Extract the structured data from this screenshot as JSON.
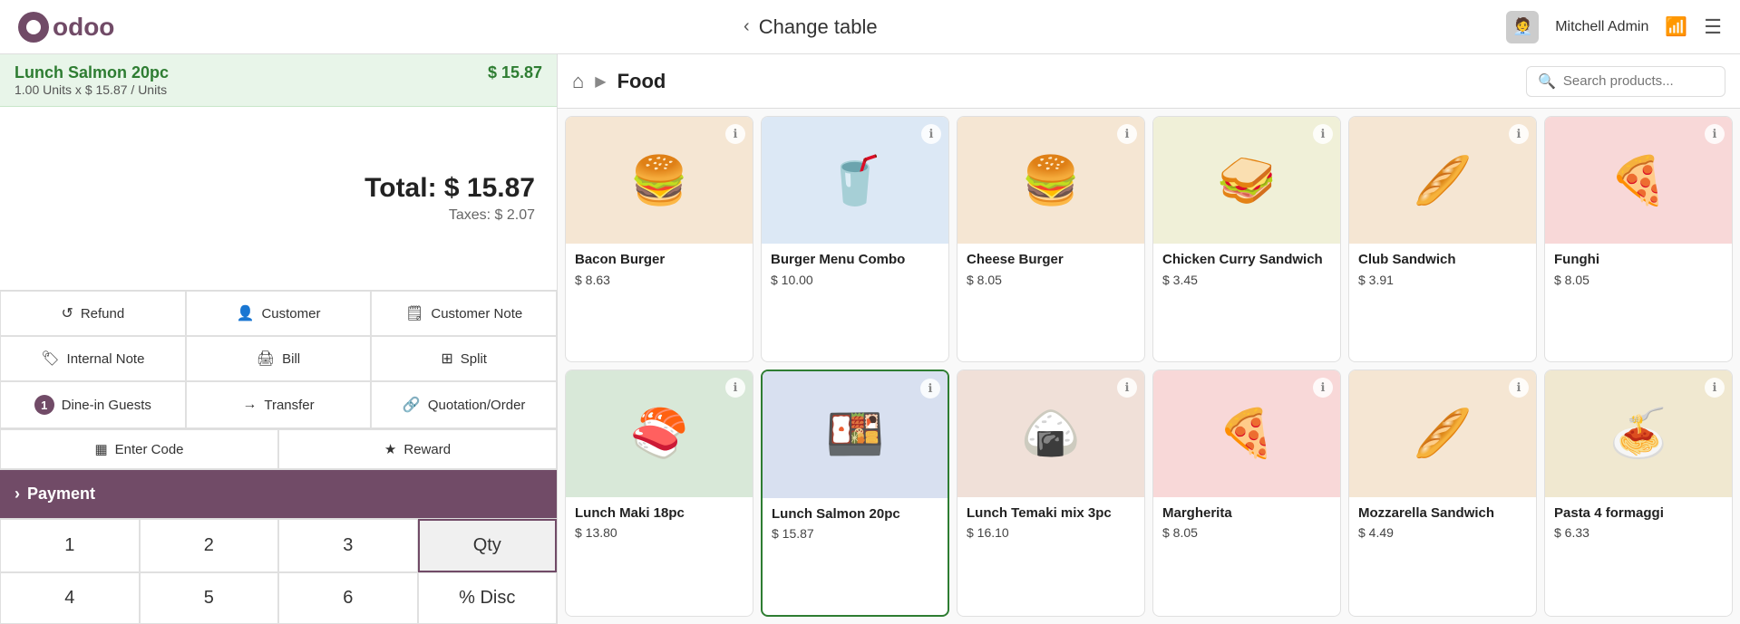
{
  "topbar": {
    "logo": "odoo",
    "change_table_label": "Change table",
    "back_icon": "‹",
    "user_name": "Mitchell Admin",
    "user_avatar": "👤",
    "wifi_icon": "📶",
    "hamburger_icon": "☰"
  },
  "left_panel": {
    "order_item": {
      "name": "Lunch Salmon 20pc",
      "price": "$ 15.87",
      "qty_label": "1.00  Units x $ 15.87 / Units"
    },
    "total": {
      "label": "Total: $ 15.87",
      "taxes": "Taxes: $ 2.07"
    },
    "buttons": [
      {
        "id": "refund",
        "icon": "↺",
        "label": "Refund"
      },
      {
        "id": "customer",
        "icon": "👤",
        "label": "Customer"
      },
      {
        "id": "customer-note",
        "icon": "🗒",
        "label": "Customer Note"
      },
      {
        "id": "internal-note",
        "icon": "🏷",
        "label": "Internal Note"
      },
      {
        "id": "bill",
        "icon": "🖨",
        "label": "Bill"
      },
      {
        "id": "split",
        "icon": "⊞",
        "label": "Split"
      },
      {
        "id": "dine-in-guests",
        "icon": "1",
        "label": "Dine-in Guests",
        "badge": "1"
      },
      {
        "id": "transfer",
        "icon": "→",
        "label": "Transfer"
      },
      {
        "id": "quotation-order",
        "icon": "🔗",
        "label": "Quotation/Order"
      }
    ],
    "bottom_actions": [
      {
        "id": "enter-code",
        "icon": "▦",
        "label": "Enter Code"
      },
      {
        "id": "reward",
        "icon": "★",
        "label": "Reward"
      }
    ],
    "payment": {
      "label": "Payment",
      "icon": "›"
    },
    "numpad": {
      "keys": [
        "1",
        "2",
        "3",
        "Qty",
        "4",
        "5",
        "6",
        "% Disc"
      ],
      "active_key": "Qty"
    }
  },
  "right_panel": {
    "home_icon": "⌂",
    "breadcrumb_sep": "▶",
    "category": "Food",
    "search_placeholder": "Search products...",
    "products": [
      {
        "id": "bacon-burger",
        "name": "Bacon Burger",
        "price": "$ 8.63",
        "emoji": "🍔"
      },
      {
        "id": "burger-menu-combo",
        "name": "Burger Menu Combo",
        "price": "$ 10.00",
        "emoji": "🥤"
      },
      {
        "id": "cheese-burger",
        "name": "Cheese Burger",
        "price": "$ 8.05",
        "emoji": "🍔"
      },
      {
        "id": "chicken-curry-sandwich",
        "name": "Chicken Curry Sandwich",
        "price": "$ 3.45",
        "emoji": "🥪"
      },
      {
        "id": "club-sandwich",
        "name": "Club Sandwich",
        "price": "$ 3.91",
        "emoji": "🥖"
      },
      {
        "id": "funghi",
        "name": "Funghi",
        "price": "$ 8.05",
        "emoji": "🍕"
      },
      {
        "id": "lunch-maki-18pc",
        "name": "Lunch Maki 18pc",
        "price": "$ 13.80",
        "emoji": "🍣"
      },
      {
        "id": "lunch-salmon-20pc",
        "name": "Lunch Salmon 20pc",
        "price": "$ 15.87",
        "emoji": "🍱",
        "selected": true
      },
      {
        "id": "lunch-temaki-mix-3pc",
        "name": "Lunch Temaki mix 3pc",
        "price": "$ 16.10",
        "emoji": "🍙"
      },
      {
        "id": "margherita",
        "name": "Margherita",
        "price": "$ 8.05",
        "emoji": "🍕"
      },
      {
        "id": "mozzarella-sandwich",
        "name": "Mozzarella Sandwich",
        "price": "$ 4.49",
        "emoji": "🥖"
      },
      {
        "id": "pasta-4-formaggi",
        "name": "Pasta 4 formaggi",
        "price": "$ 6.33",
        "emoji": "🍝"
      }
    ]
  }
}
